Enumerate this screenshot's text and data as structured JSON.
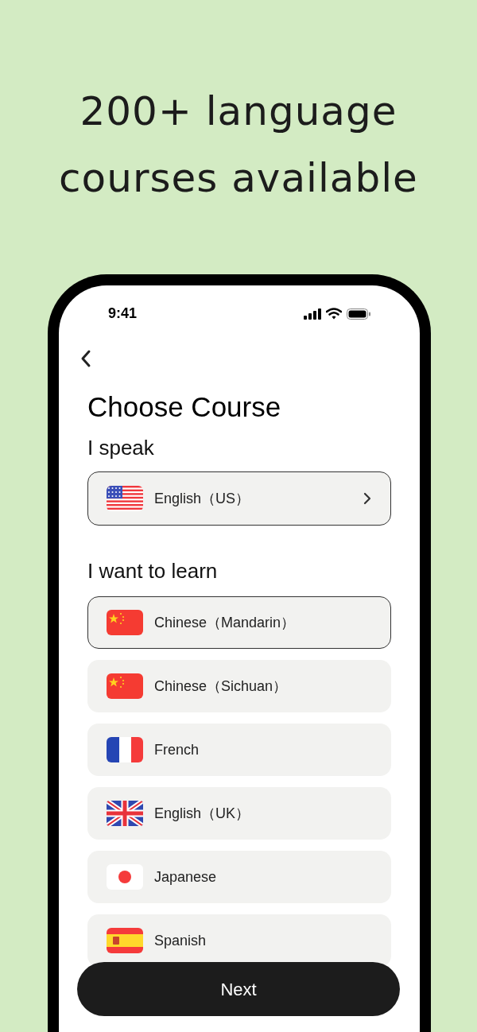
{
  "headline": [
    "200+ language",
    "courses available"
  ],
  "status_bar": {
    "time": "9:41"
  },
  "title": "Choose Course",
  "speak": {
    "label": "I speak",
    "language": {
      "name": "English（US）",
      "kind": "us"
    }
  },
  "learn": {
    "label": "I want to learn",
    "options": [
      {
        "name": "Chinese（Mandarin）",
        "kind": "cn",
        "selected": true
      },
      {
        "name": "Chinese（Sichuan）",
        "kind": "cn",
        "selected": false
      },
      {
        "name": "French",
        "kind": "fr",
        "selected": false
      },
      {
        "name": "English（UK）",
        "kind": "gb",
        "selected": false
      },
      {
        "name": "Japanese",
        "kind": "jp",
        "selected": false
      },
      {
        "name": "Spanish",
        "kind": "es",
        "selected": false
      }
    ]
  },
  "next_button": "Next"
}
